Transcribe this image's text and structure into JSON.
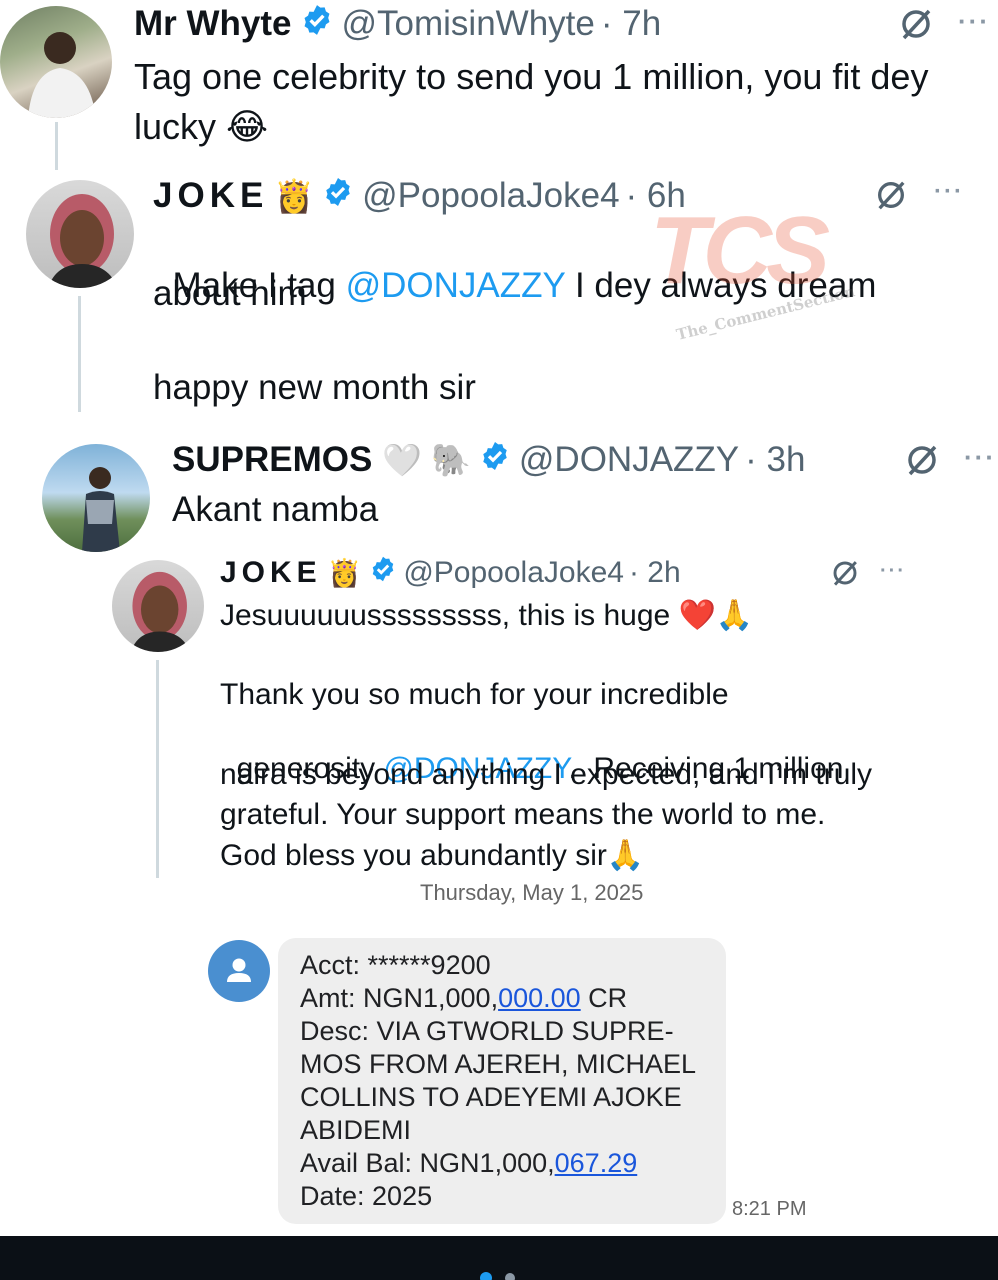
{
  "tweet1": {
    "name": "Mr Whyte",
    "handle": "@TomisinWhyte",
    "time": "· 7h",
    "text_line1": "Tag one celebrity to send you 1 million, you fit dey",
    "text_line2": "lucky 😂"
  },
  "tweet2": {
    "name": "JOKE",
    "emoji": "👸",
    "handle": "@PopoolaJoke4",
    "time": "· 6h",
    "text_pre": "Make I tag ",
    "mention": "@DONJAZZY",
    "text_post": " I dey always dream",
    "text_line2": "about him",
    "text_line3": "happy new month sir"
  },
  "tweet3": {
    "name": "SUPREMOS",
    "emojis": "🤍 🐘",
    "handle": "@DONJAZZY",
    "time": "· 3h",
    "text": "Akant namba"
  },
  "tweet4": {
    "name": "JOKE",
    "emoji": "👸",
    "handle": "@PopoolaJoke4",
    "time": "· 2h",
    "text_line1": "Jesuuuuuusssssssss, this is huge ❤️🙏",
    "para2_line1": "Thank you so much for your incredible",
    "para2_line2_pre": "generosity ",
    "para2_mention": "@DONJAZZY",
    "para2_line2_post": ".  Receiving 1 million",
    "para2_line3": "naira is beyond anything I expected, and I’m truly",
    "para2_line4": "grateful. Your support means the world to me.",
    "para2_line5": "God bless you abundantly sir🙏"
  },
  "watermark": {
    "logo": "TCS",
    "caption": "The_CommentSection"
  },
  "sms": {
    "date": "Thursday, May 1, 2025",
    "acct": "Acct: ******9200",
    "amt_pre": "Amt: NGN1,000,",
    "amt_link": "000.00",
    "amt_post": " CR",
    "desc1": "Desc: VIA GTWORLD SUPRE-",
    "desc2": "MOS FROM AJEREH, MICHAEL",
    "desc3": "COLLINS TO ADEYEMI AJOKE",
    "desc4": "ABIDEMI",
    "bal_pre": "Avail Bal: NGN1,000,",
    "bal_link": "067.29",
    "date_line": "Date: 2025",
    "time": "8:21 PM"
  },
  "colors": {
    "verified": "#1d9bf0",
    "mention": "#1d9bf0",
    "thread_line": "#cfd9de",
    "sms_avatar": "#4a8fd0"
  },
  "more_label": "···"
}
